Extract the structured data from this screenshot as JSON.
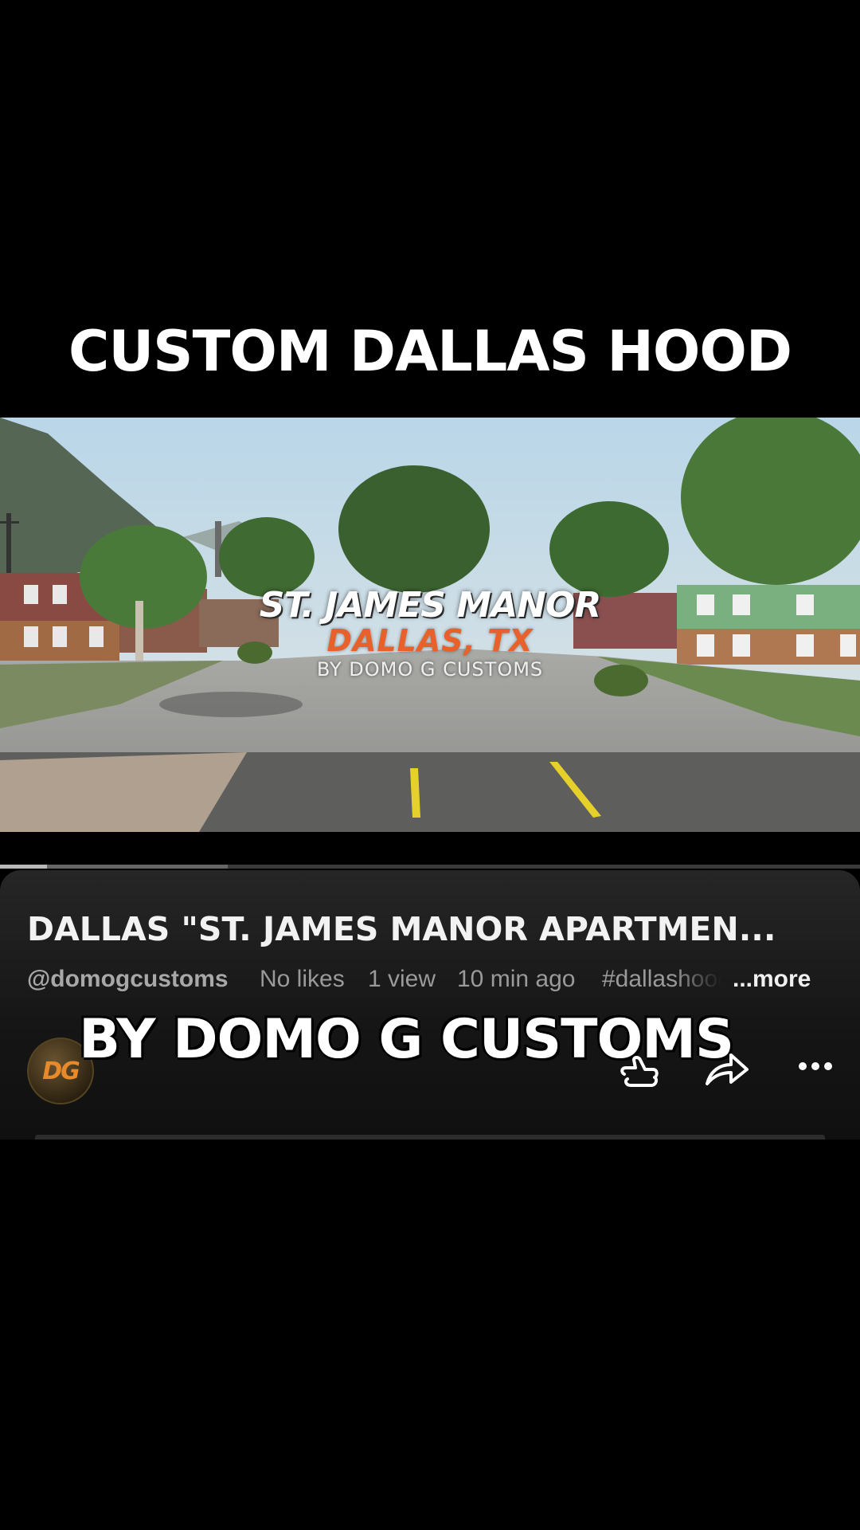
{
  "overlay": {
    "top_title": "CUSTOM DALLAS HOOD",
    "caption": "BY DOMO G CUSTOMS"
  },
  "video": {
    "title_line1": "ST. JAMES MANOR",
    "title_line2": "DALLAS, TX",
    "title_line3": "BY DOMO G CUSTOMS",
    "progress": 0.055,
    "buffered": 0.265
  },
  "info": {
    "title": "DALLAS \"ST. JAMES MANOR APARTMEN...",
    "channel_handle": "@domogcustoms",
    "likes": "No likes",
    "views": "1 view",
    "time_ago": "10 min ago",
    "hashtag": "#dallashood",
    "more_label": "...more"
  },
  "channel": {
    "avatar_text": "DG"
  },
  "icons": {
    "like": "thumbs-up-icon",
    "share": "share-arrow-icon",
    "more": "more-horizontal-icon"
  },
  "colors": {
    "accent_orange": "#e8612a",
    "panel_bg": "#1c1c1c"
  }
}
